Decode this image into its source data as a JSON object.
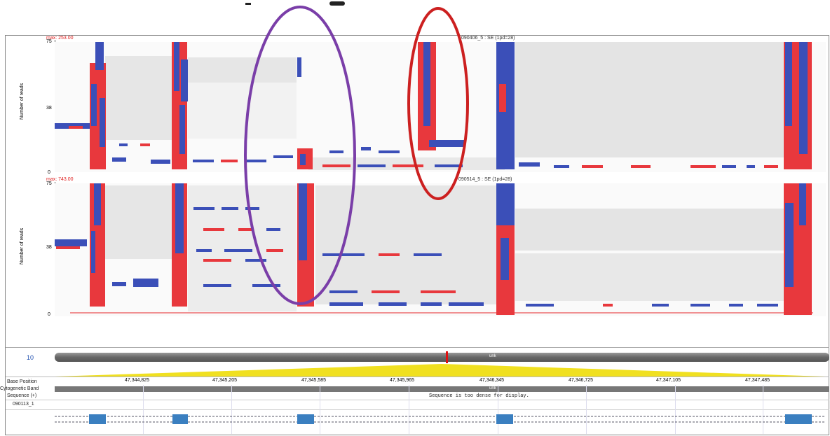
{
  "tracks": [
    {
      "max_label": "max: 253.00",
      "track_name": "090406_5 : SE (1pd=28)",
      "y_axis_label": "Number of reads",
      "y_ticks": [
        "75",
        "38",
        "0"
      ]
    },
    {
      "max_label": "max: 743.00",
      "track_name": "090514_5 : SE (1pd=28)",
      "y_axis_label": "Number of reads",
      "y_ticks": [
        "75",
        "38",
        "0"
      ]
    }
  ],
  "chromosome": {
    "number": "10",
    "band_center_label": "unk"
  },
  "rows": {
    "base_position_label": "Base Position",
    "cytogenetic_band_label": "Cytogenetic Band",
    "cytogenetic_band_value": "unk",
    "sequence_label": "Sequence (+)",
    "sequence_message": "Sequence is too dense for display.",
    "gene_label": "090113_1"
  },
  "base_positions": [
    "47,344,825",
    "47,345,205",
    "47,345,585",
    "47,345,965",
    "47,346,345",
    "47,346,725",
    "47,347,105",
    "47,347,485"
  ],
  "colors": {
    "forward_read": "#e8383d",
    "reverse_read": "#3b4fb8",
    "purple_circle": "#7a3ea8",
    "red_circle": "#cc2020",
    "exon": "#3a7fc0",
    "ideogram_highlight": "#f0e020"
  }
}
